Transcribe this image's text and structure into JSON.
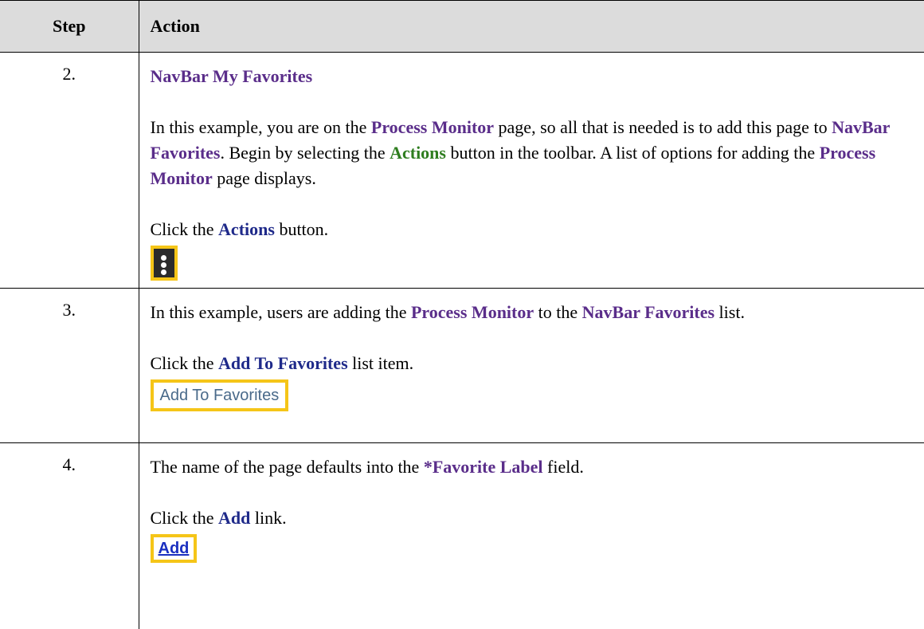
{
  "header": {
    "step": "Step",
    "action": "Action"
  },
  "rows": [
    {
      "step": "2.",
      "title": "NavBar My Favorites",
      "para": [
        "In this example, you are on the ",
        "Process Monitor",
        " page, so all that is needed is to add this page to ",
        "NavBar Favorites",
        ". Begin by selecting the ",
        "Actions",
        " button in the toolbar. A list of options for adding the ",
        "Process Monitor",
        " page displays."
      ],
      "instr": [
        "Click the ",
        "Actions",
        " button."
      ],
      "graphic": "kebab-menu-icon"
    },
    {
      "step": "3.",
      "para": [
        "In this example, users are adding the ",
        "Process Monitor",
        " to the ",
        "NavBar Favorites",
        " list."
      ],
      "instr": [
        "Click the ",
        "Add To Favorites",
        " list item."
      ],
      "graphic_label": "Add To Favorites"
    },
    {
      "step": "4.",
      "para": [
        "The name of the page defaults into the ",
        "*Favorite Label",
        " field."
      ],
      "instr": [
        "Click the ",
        "Add",
        " link."
      ],
      "graphic_label": "Add"
    }
  ],
  "colors": {
    "highlight_border": "#f5c518",
    "purple_term": "#5a2d8a",
    "navy_term": "#1f2a8a",
    "green_term": "#2e7d1f"
  }
}
